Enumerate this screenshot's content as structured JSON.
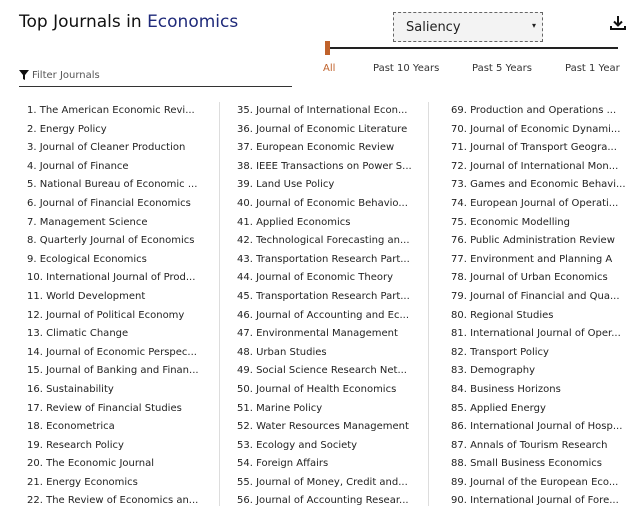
{
  "header": {
    "title_prefix": "Top Journals in ",
    "title_field": "Economics",
    "sort_select": {
      "value": "Saliency",
      "caret": "▾"
    },
    "download_icon": "download-icon"
  },
  "time_filter": {
    "options": [
      "All",
      "Past 10 Years",
      "Past 5 Years",
      "Past 1 Year"
    ],
    "active": "All",
    "accent_color": "#c0622b"
  },
  "filter": {
    "placeholder": "Filter Journals"
  },
  "journals": {
    "col1": [
      "1. The American Economic Revi...",
      "2. Energy Policy",
      "3. Journal of Cleaner Production",
      "4. Journal of Finance",
      "5. National Bureau of Economic ...",
      "6. Journal of Financial Economics",
      "7. Management Science",
      "8. Quarterly Journal of Economics",
      "9. Ecological Economics",
      "10. International Journal of Prod...",
      "11. World Development",
      "12. Journal of Political Economy",
      "13. Climatic Change",
      "14. Journal of Economic Perspec...",
      "15. Journal of Banking and Finan...",
      "16. Sustainability",
      "17. Review of Financial Studies",
      "18. Econometrica",
      "19. Research Policy",
      "20. The Economic Journal",
      "21. Energy Economics",
      "22. The Review of Economics an..."
    ],
    "col2": [
      "35. Journal of International Econ...",
      "36. Journal of Economic Literature",
      "37. European Economic Review",
      "38. IEEE Transactions on Power S...",
      "39. Land Use Policy",
      "40. Journal of Economic Behavio...",
      "41. Applied Economics",
      "42. Technological Forecasting an...",
      "43. Transportation Research Part...",
      "44. Journal of Economic Theory",
      "45. Transportation Research Part...",
      "46. Journal of Accounting and Ec...",
      "47. Environmental Management",
      "48. Urban Studies",
      "49. Social Science Research Net...",
      "50. Journal of Health Economics",
      "51. Marine Policy",
      "52. Water Resources Management",
      "53. Ecology and Society",
      "54. Foreign Affairs",
      "55. Journal of Money, Credit and...",
      "56. Journal of Accounting Resear..."
    ],
    "col3": [
      "69. Production and Operations ...",
      "70. Journal of Economic Dynami...",
      "71. Journal of Transport Geogra...",
      "72. Journal of International Mon...",
      "73. Games and Economic Behavi...",
      "74. European Journal of Operati...",
      "75. Economic Modelling",
      "76. Public Administration Review",
      "77. Environment and Planning A",
      "78. Journal of Urban Economics",
      "79. Journal of Financial and Qua...",
      "80. Regional Studies",
      "81. International Journal of Oper...",
      "82. Transport Policy",
      "83. Demography",
      "84. Business Horizons",
      "85. Applied Energy",
      "86. International Journal of Hosp...",
      "87. Annals of Tourism Research",
      "88. Small Business Economics",
      "89. Journal of the European Eco...",
      "90. International Journal of Fore..."
    ]
  }
}
